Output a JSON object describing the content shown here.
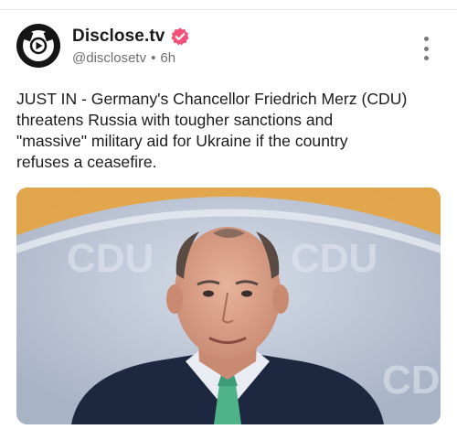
{
  "post": {
    "author": {
      "display_name": "Disclose.tv",
      "handle": "@disclosetv",
      "separator": "•",
      "time_ago": "6h",
      "verified": true,
      "avatar_icon": "disclose-tv-logo-icon",
      "verified_color": "#f0527a"
    },
    "menu_icon": "more-vertical-icon",
    "text": "JUST IN - Germany's Chancellor Friedrich Merz (CDU)\nthreatens Russia with tougher sanctions and\n\"massive\" military aid for Ukraine if the country\nrefuses a ceasefire.",
    "media": {
      "type": "photo",
      "background_text": [
        "CDU",
        "CDU",
        "CDU"
      ],
      "accent_colors": {
        "orange": "#e7a33e",
        "backdrop": "#b9c4d6",
        "tie": "#4fb38a",
        "suit": "#1e2740"
      }
    }
  }
}
